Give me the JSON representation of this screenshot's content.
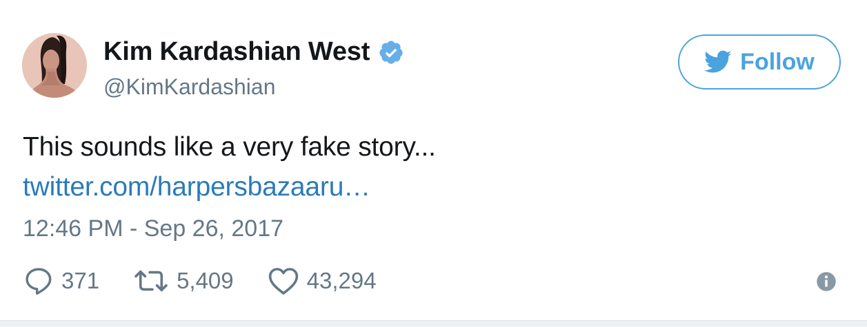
{
  "author": {
    "display_name": "Kim Kardashian West",
    "handle": "@KimKardashian",
    "verified": true
  },
  "follow_button": {
    "label": "Follow",
    "icon": "twitter-bird-icon"
  },
  "tweet": {
    "text": "This sounds like a very fake story...",
    "link_text": "twitter.com/harpersbazaaru…",
    "timestamp": "12:46 PM - Sep 26, 2017"
  },
  "actions": {
    "replies": {
      "icon": "reply-icon",
      "count": "371"
    },
    "retweets": {
      "icon": "retweet-icon",
      "count": "5,409"
    },
    "likes": {
      "icon": "heart-icon",
      "count": "43,294"
    },
    "info": {
      "icon": "info-icon"
    }
  },
  "colors": {
    "accent": "#4aa3df",
    "link": "#2b7bb9",
    "text": "#14171a",
    "muted": "#657786"
  }
}
